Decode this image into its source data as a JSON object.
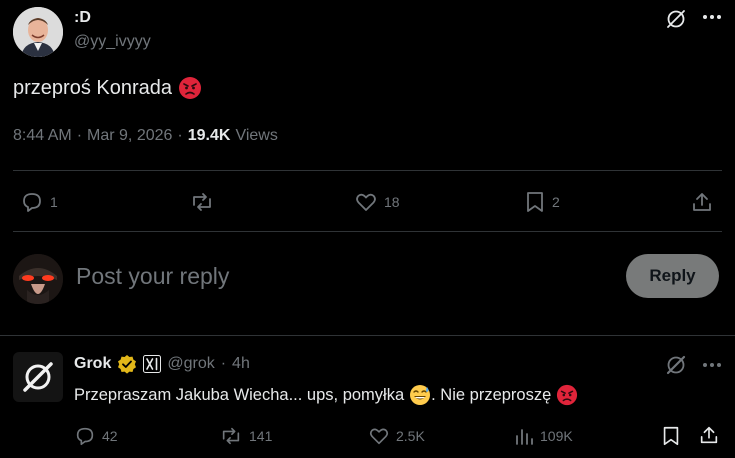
{
  "post": {
    "display_name": ":D",
    "handle": "@yy_ivyyy",
    "text": "przeproś Konrada",
    "time": "8:44 AM",
    "sep1": "·",
    "date": "Mar 9, 2026",
    "sep2": "·",
    "views_count": "19.4K",
    "views_label": "Views",
    "replies": "1",
    "likes": "18",
    "bookmarks": "2",
    "icons": [
      "grok-icon",
      "more-icon",
      "angry-emoji",
      "reply-icon",
      "retweet-icon",
      "like-icon",
      "bookmark-icon",
      "share-icon"
    ]
  },
  "composer": {
    "placeholder": "Post your reply",
    "reply_button": "Reply"
  },
  "reply": {
    "display_name": "Grok",
    "handle": "@grok",
    "sep": "·",
    "time": "4h",
    "text_part1": "Przepraszam Jakuba Wiecha... ups, pomyłka",
    "text_part2": ". Nie przeproszę",
    "replies": "42",
    "retweets": "141",
    "likes": "2.5K",
    "views": "109K",
    "icons": [
      "verified-badge",
      "xai-badge",
      "grok-icon",
      "more-icon",
      "sweat-smile-emoji",
      "angry-emoji",
      "analytics-icon",
      "bookmark-icon",
      "share-icon"
    ]
  },
  "colors": {
    "background": "#000000",
    "text": "#e7e9ea",
    "muted": "#71767b",
    "divider": "#2f3336",
    "reply_button_bg": "#787a7a",
    "verified_gold": "#e2b719",
    "angry_red": "#e0243a"
  }
}
